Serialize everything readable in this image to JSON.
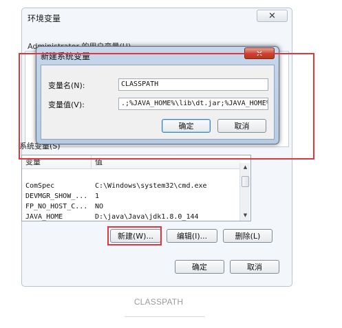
{
  "env_dialog": {
    "title": "环境变量",
    "close_glyph": "✕",
    "user_vars_label": "Administrator 的用户变量(U)",
    "system_vars_label": "系统变量(S)",
    "columns": [
      "变量",
      "值"
    ],
    "system_vars": [
      {
        "name": "ComSpec",
        "value": "C:\\Windows\\system32\\cmd.exe"
      },
      {
        "name": "DEVMGR_SHOW_...",
        "value": "1"
      },
      {
        "name": "FP_NO_HOST_C...",
        "value": "NO"
      },
      {
        "name": "JAVA_HOME",
        "value": "D:\\java\\Java\\jdk1.8.0_144"
      }
    ],
    "buttons": {
      "new": "新建(W)...",
      "edit": "编辑(I)...",
      "delete": "删除(L)",
      "ok": "确定",
      "cancel": "取消"
    }
  },
  "new_var_dialog": {
    "title": "新建系统变量",
    "close_glyph": "✕",
    "name_label": "变量名(N):",
    "name_value": "CLASSPATH",
    "value_label": "变量值(V):",
    "value_value": ".;%JAVA_HOME%\\lib\\dt.jar;%JAVA_HOME%\\lib\\tools.jar",
    "ok_label": "确定",
    "cancel_label": "取消"
  },
  "caption": "CLASSPATH",
  "colors": {
    "highlight_red": "#e0353c",
    "dialog_frame_blue": "#b7cbe3",
    "close_red": "#c8452d"
  }
}
